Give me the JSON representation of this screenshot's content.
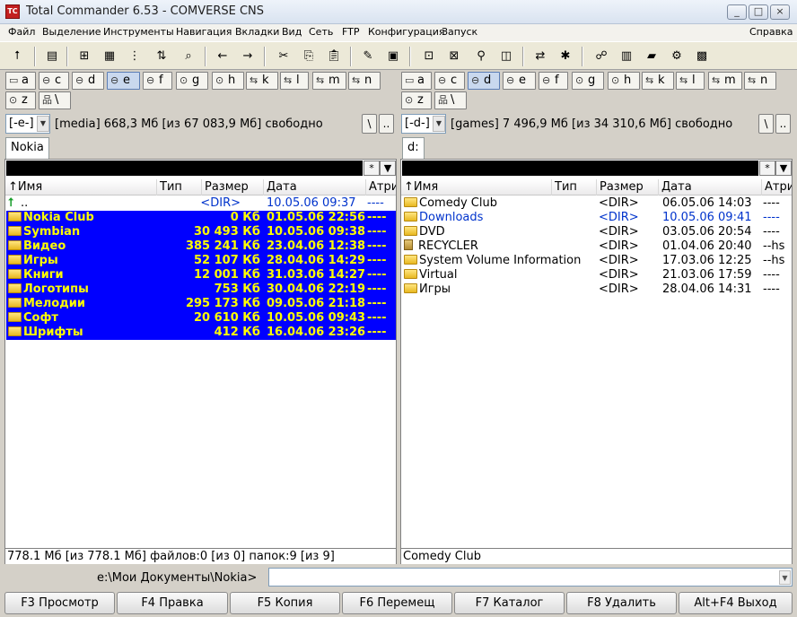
{
  "window": {
    "title": "Total Commander 6.53 - COMVERSE CNS",
    "controls": [
      "_",
      "□",
      "×"
    ]
  },
  "menu": {
    "items": [
      "Файл",
      "Выделение",
      "Инструменты",
      "Навигация",
      "Вкладки",
      "Вид",
      "Сеть",
      "FTP",
      "Конфигурация",
      "Запуск"
    ],
    "help": "Справка"
  },
  "toolbar_icons": [
    "refresh-icon",
    "view-mode-icon",
    "tree-icon",
    "thumbnails-icon",
    "branch-icon",
    "sort-icon",
    "find-icon",
    "back-icon",
    "forward-icon",
    "cut-icon",
    "copy-icon",
    "paste-icon",
    "notepad-icon",
    "archive-icon",
    "pack-icon",
    "unpack-icon",
    "search-icon",
    "compare-icon",
    "sync-icon",
    "rename-icon",
    "ftp-icon",
    "notes-icon",
    "book-icon",
    "settings-icon",
    "calc-icon"
  ],
  "left_panel": {
    "drives": [
      "a",
      "c",
      "d",
      "e",
      "f",
      "g",
      "h",
      "k",
      "l",
      "m",
      "n",
      "z",
      "\\"
    ],
    "active_drive": "e",
    "drive_combo": "[-e-]",
    "free_space": "[media]  668,3 Мб  [из 67 083,9 Мб]  свободно",
    "root_btn": "\\",
    "up_btn": "..",
    "tab": "Nokia",
    "filter_btn": "*",
    "columns": [
      "↑Имя",
      "Тип",
      "Размер",
      "Дата",
      "Атри"
    ],
    "rows": [
      {
        "name": "..",
        "size": "<DIR>",
        "date": "10.05.06 09:37",
        "attr": "----",
        "kind": "up",
        "selected": false
      },
      {
        "name": "Nokia Club",
        "size": "0 Кб",
        "date": "01.05.06 22:56",
        "attr": "----",
        "kind": "folder",
        "selected": true
      },
      {
        "name": "Symbian",
        "size": "30 493 Кб",
        "date": "10.05.06 09:38",
        "attr": "----",
        "kind": "folder",
        "selected": true
      },
      {
        "name": "Видео",
        "size": "385 241 Кб",
        "date": "23.04.06 12:38",
        "attr": "----",
        "kind": "folder",
        "selected": true
      },
      {
        "name": "Игры",
        "size": "52 107 Кб",
        "date": "28.04.06 14:29",
        "attr": "----",
        "kind": "folder",
        "selected": true
      },
      {
        "name": "Книги",
        "size": "12 001 Кб",
        "date": "31.03.06 14:27",
        "attr": "----",
        "kind": "folder",
        "selected": true
      },
      {
        "name": "Логотипы",
        "size": "753 Кб",
        "date": "30.04.06 22:19",
        "attr": "----",
        "kind": "folder",
        "selected": true
      },
      {
        "name": "Мелодии",
        "size": "295 173 Кб",
        "date": "09.05.06 21:18",
        "attr": "----",
        "kind": "folder",
        "selected": true
      },
      {
        "name": "Софт",
        "size": "20 610 Кб",
        "date": "10.05.06 09:43",
        "attr": "----",
        "kind": "folder",
        "selected": true
      },
      {
        "name": "Шрифты",
        "size": "412 Кб",
        "date": "16.04.06 23:26",
        "attr": "----",
        "kind": "folder",
        "selected": true
      }
    ],
    "status": "778.1 Мб [из 778.1 Мб] файлов:0 [из 0] папок:9 [из 9]"
  },
  "right_panel": {
    "drives": [
      "a",
      "c",
      "d",
      "e",
      "f",
      "g",
      "h",
      "k",
      "l",
      "m",
      "n",
      "z",
      "\\"
    ],
    "active_drive": "d",
    "drive_combo": "[-d-]",
    "free_space": "[games]  7 496,9 Мб  [из 34 310,6 Мб]  свободно",
    "root_btn": "\\",
    "up_btn": "..",
    "tab": "d:",
    "filter_btn": "*",
    "columns": [
      "↑Имя",
      "Тип",
      "Размер",
      "Дата",
      "Атри"
    ],
    "rows": [
      {
        "name": "Comedy Club",
        "size": "<DIR>",
        "date": "06.05.06 14:03",
        "attr": "----",
        "kind": "folder"
      },
      {
        "name": "Downloads",
        "size": "<DIR>",
        "date": "10.05.06 09:41",
        "attr": "----",
        "kind": "link"
      },
      {
        "name": "DVD",
        "size": "<DIR>",
        "date": "03.05.06 20:54",
        "attr": "----",
        "kind": "folder"
      },
      {
        "name": "RECYCLER",
        "size": "<DIR>",
        "date": "01.04.06 20:40",
        "attr": "--hs",
        "kind": "recycler"
      },
      {
        "name": "System Volume Information",
        "size": "<DIR>",
        "date": "17.03.06 12:25",
        "attr": "--hs",
        "kind": "folder"
      },
      {
        "name": "Virtual",
        "size": "<DIR>",
        "date": "21.03.06 17:59",
        "attr": "----",
        "kind": "folder"
      },
      {
        "name": "Игры",
        "size": "<DIR>",
        "date": "28.04.06 14:31",
        "attr": "----",
        "kind": "folder"
      }
    ],
    "status": "Comedy Club"
  },
  "command_line": {
    "path": "e:\\Мои Документы\\Nokia>",
    "value": ""
  },
  "fkeys": [
    "F3 Просмотр",
    "F4 Правка",
    "F5 Копия",
    "F6 Перемещ",
    "F7 Каталог",
    "F8 Удалить",
    "Alt+F4 Выход"
  ],
  "colors": {
    "selection_bg": "#0000ff",
    "selection_fg": "#ffff00",
    "link_blue": "#0033cc",
    "window_bg": "#d4d0c8"
  }
}
